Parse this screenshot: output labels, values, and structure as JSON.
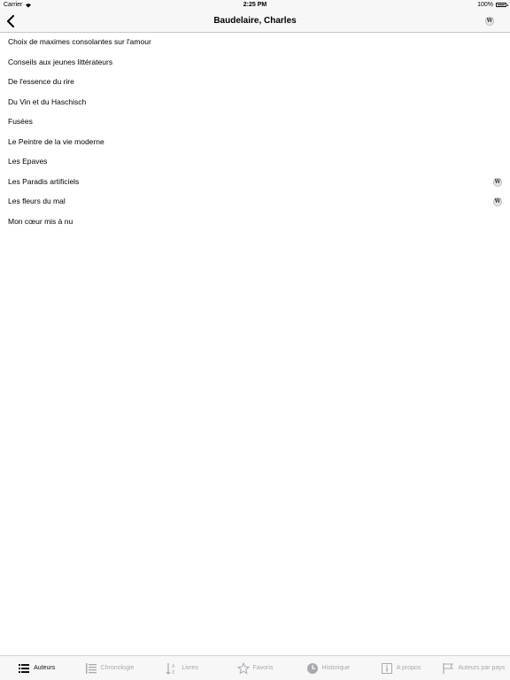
{
  "status_bar": {
    "carrier": "Carrier",
    "time": "2:25 PM",
    "battery": "100%"
  },
  "nav": {
    "title": "Baudelaire, Charles",
    "wiki_glyph": "W"
  },
  "list": {
    "items": [
      {
        "label": "Choix de maximes consolantes sur l'amour",
        "wiki": false
      },
      {
        "label": "Conseils aux jeunes littérateurs",
        "wiki": false
      },
      {
        "label": "De l'essence du rire",
        "wiki": false
      },
      {
        "label": "Du Vin et du Haschisch",
        "wiki": false
      },
      {
        "label": "Fusées",
        "wiki": false
      },
      {
        "label": "Le Peintre de la vie moderne",
        "wiki": false
      },
      {
        "label": "Les Epaves",
        "wiki": false
      },
      {
        "label": "Les Paradis artificiels",
        "wiki": true
      },
      {
        "label": "Les fleurs du mal",
        "wiki": true
      },
      {
        "label": "Mon cœur mis à nu",
        "wiki": false
      }
    ]
  },
  "tabs": {
    "items": [
      {
        "label": "Auteurs",
        "icon": "list-icon",
        "active": true
      },
      {
        "label": "Chronologie",
        "icon": "timeline-list-icon",
        "active": false
      },
      {
        "label": "Livres",
        "icon": "sort-az-icon",
        "active": false
      },
      {
        "label": "Favoris",
        "icon": "star-icon",
        "active": false
      },
      {
        "label": "Historique",
        "icon": "clock-icon",
        "active": false
      },
      {
        "label": "A propos",
        "icon": "info-icon",
        "active": false
      },
      {
        "label": "Auteurs par pays",
        "icon": "flag-icon",
        "active": false
      }
    ]
  }
}
